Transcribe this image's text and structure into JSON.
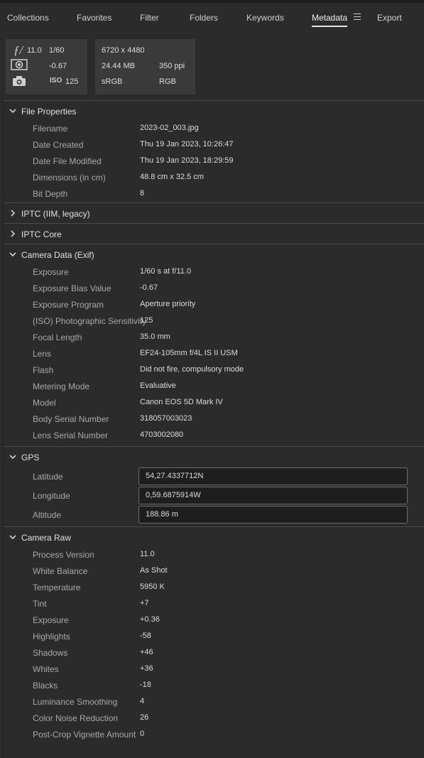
{
  "tabs": [
    "Collections",
    "Favorites",
    "Filter",
    "Folders",
    "Keywords",
    "Metadata",
    "Export"
  ],
  "summary": {
    "aperture": "11.0",
    "shutter": "1/60",
    "exposure_bias": "-0.67",
    "iso_label": "ISO",
    "iso": "125",
    "dimensions": "6720 x 4480",
    "file_size": "24.44 MB",
    "resolution": "350 ppi",
    "color_profile": "sRGB",
    "color_mode": "RGB"
  },
  "file_properties": {
    "title": "File Properties",
    "rows": [
      {
        "k": "Filename",
        "v": "2023-02_003.jpg"
      },
      {
        "k": "Date Created",
        "v": "Thu 19 Jan 2023, 10:26:47"
      },
      {
        "k": "Date File Modified",
        "v": "Thu 19 Jan 2023, 18:29:59"
      },
      {
        "k": "Dimensions (in cm)",
        "v": "48.8 cm x 32.5 cm"
      },
      {
        "k": "Bit Depth",
        "v": "8"
      }
    ]
  },
  "iptc_iim": {
    "title": "IPTC (IIM, legacy)"
  },
  "iptc_core": {
    "title": "IPTC Core"
  },
  "camera_data": {
    "title": "Camera Data (Exif)",
    "rows": [
      {
        "k": "Exposure",
        "v": "1/60 s at f/11.0"
      },
      {
        "k": "Exposure Bias Value",
        "v": "-0.67"
      },
      {
        "k": "Exposure Program",
        "v": "Aperture priority"
      },
      {
        "k": "(ISO) Photographic Sensitivity",
        "v": "125"
      },
      {
        "k": "Focal Length",
        "v": "35.0 mm"
      },
      {
        "k": "Lens",
        "v": "EF24-105mm f/4L IS II USM"
      },
      {
        "k": "Flash",
        "v": "Did not fire, compulsory mode"
      },
      {
        "k": "Metering Mode",
        "v": "Evaluative"
      },
      {
        "k": "Model",
        "v": "Canon EOS 5D Mark IV"
      },
      {
        "k": "Body Serial Number",
        "v": "318057003023"
      },
      {
        "k": "Lens Serial Number",
        "v": "4703002080"
      }
    ]
  },
  "gps": {
    "title": "GPS",
    "rows": [
      {
        "k": "Latitude",
        "v": "54,27.4337712N"
      },
      {
        "k": "Longitude",
        "v": "0,59.6875914W"
      },
      {
        "k": "Altitude",
        "v": "188.86 m"
      }
    ]
  },
  "camera_raw": {
    "title": "Camera Raw",
    "rows": [
      {
        "k": "Process Version",
        "v": "11.0"
      },
      {
        "k": "White Balance",
        "v": "As Shot"
      },
      {
        "k": "Temperature",
        "v": "5950 K"
      },
      {
        "k": "Tint",
        "v": "+7"
      },
      {
        "k": "Exposure",
        "v": "+0.36"
      },
      {
        "k": "Highlights",
        "v": "-58"
      },
      {
        "k": "Shadows",
        "v": "+46"
      },
      {
        "k": "Whites",
        "v": "+36"
      },
      {
        "k": "Blacks",
        "v": "-18"
      },
      {
        "k": "Luminance Smoothing",
        "v": "4"
      },
      {
        "k": "Color Noise Reduction",
        "v": "26"
      },
      {
        "k": "Post-Crop Vignette Amount",
        "v": "0"
      }
    ]
  }
}
